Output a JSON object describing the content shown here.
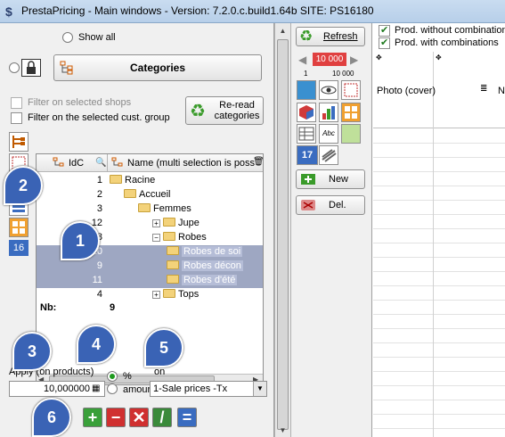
{
  "window": {
    "title": "PrestaPricing - Main windows  -  Version:  7.2.0.c.build1.64b   SITE: PS16180"
  },
  "left": {
    "show_all_label": "Show all",
    "categories_button": "Categories",
    "filter_shops_label": "Filter on selected shops",
    "filter_cust_group_label": "Filter on the selected cust. group",
    "reread_button": "Re-read categories",
    "side_counter": "16",
    "grid": {
      "col_id": "IdC",
      "col_name": "Name (multi selection is poss",
      "rows": [
        {
          "id": "1",
          "name": "Racine",
          "depth": 0,
          "expander": "",
          "selected": false
        },
        {
          "id": "2",
          "name": "Accueil",
          "depth": 1,
          "expander": "",
          "selected": false
        },
        {
          "id": "3",
          "name": "Femmes",
          "depth": 2,
          "expander": "",
          "selected": false
        },
        {
          "id": "12",
          "name": "Jupe",
          "depth": 3,
          "expander": "+",
          "selected": false
        },
        {
          "id": "8",
          "name": "Robes",
          "depth": 3,
          "expander": "−",
          "selected": false
        },
        {
          "id": "10",
          "name": "Robes de soi",
          "depth": 4,
          "expander": "",
          "selected": true
        },
        {
          "id": "9",
          "name": "Robes décon",
          "depth": 4,
          "expander": "",
          "selected": true
        },
        {
          "id": "11",
          "name": "Robes d'été",
          "depth": 4,
          "expander": "",
          "selected": true
        },
        {
          "id": "4",
          "name": "Tops",
          "depth": 3,
          "expander": "+",
          "selected": false
        }
      ],
      "footer_label": "Nb:",
      "footer_count": "9"
    },
    "apply_label": "Apply (on products)",
    "percent_label": "%",
    "amount_label": "amour",
    "on_label": "on",
    "amount_value": "10,000000",
    "price_select": "1-Sale prices -Tx",
    "callouts": [
      "1",
      "2",
      "3",
      "4",
      "5",
      "6"
    ]
  },
  "right": {
    "refresh_button": "Refresh",
    "price_value": "10 000",
    "range_min": "1",
    "range_max": "10 000",
    "new_button": "New",
    "del_button": "Del.",
    "prod_without_combinations": "Prod. without combinations",
    "prod_with_combinations": "Prod. with combinations",
    "col_photo": "Photo (cover)",
    "col_name": "N",
    "tool_counter": "17",
    "tool_abc": "Abc"
  },
  "colors": {
    "callout": "#3a63b5",
    "selection": "#9ea7c2",
    "folder": "#f3d27a"
  }
}
